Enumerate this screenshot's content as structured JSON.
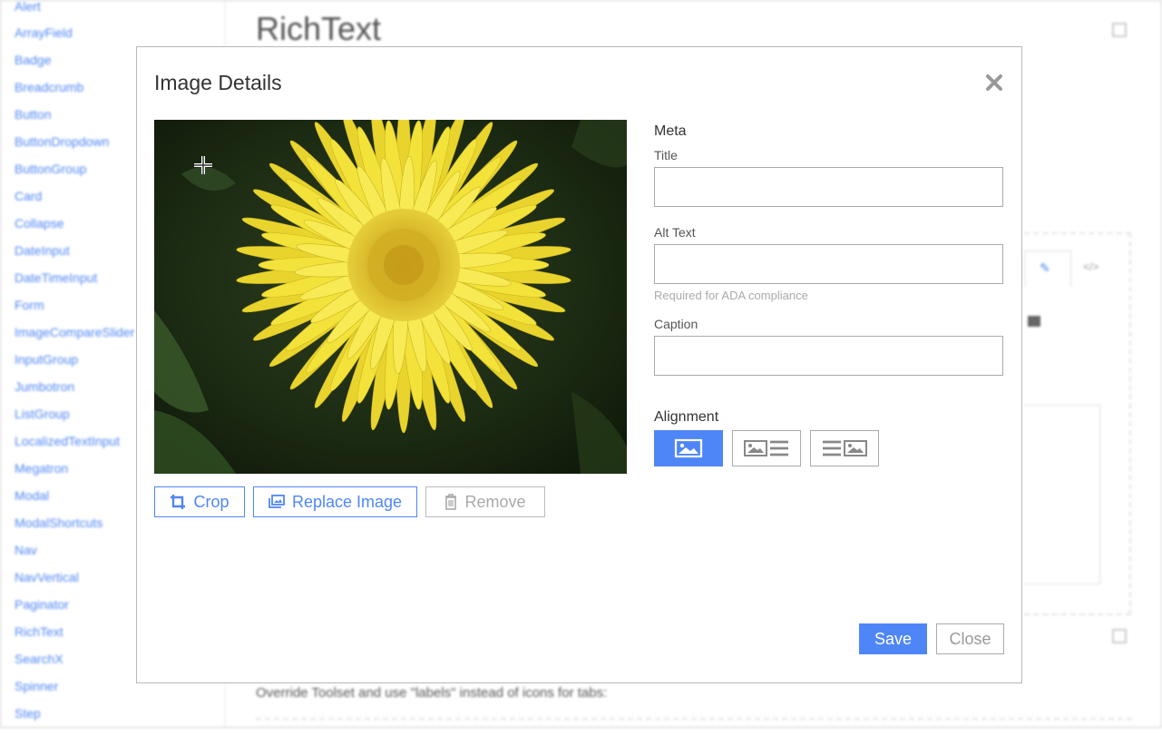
{
  "background": {
    "page_title": "RichText",
    "sidebar_items": [
      "Alert",
      "ArrayField",
      "Badge",
      "Breadcrumb",
      "Button",
      "ButtonDropdown",
      "ButtonGroup",
      "Card",
      "Collapse",
      "DateInput",
      "DateTimeInput",
      "Form",
      "ImageCompareSlider",
      "InputGroup",
      "Jumbotron",
      "ListGroup",
      "LocalizedTextInput",
      "Megatron",
      "Modal",
      "ModalShortcuts",
      "Nav",
      "NavVertical",
      "Paginator",
      "RichText",
      "SearchX",
      "Spinner",
      "Step"
    ],
    "override_text": "Override Toolset and use \"labels\" instead of icons for tabs:"
  },
  "modal": {
    "title": "Image Details",
    "image_alt": "Yellow gerbera daisy",
    "buttons": {
      "crop": "Crop",
      "replace": "Replace Image",
      "remove": "Remove"
    },
    "meta": {
      "heading": "Meta",
      "title_label": "Title",
      "title_value": "",
      "alt_label": "Alt Text",
      "alt_value": "",
      "alt_help": "Required for ADA compliance",
      "caption_label": "Caption",
      "caption_value": ""
    },
    "alignment": {
      "heading": "Alignment",
      "options": [
        "center",
        "left",
        "right"
      ],
      "selected": "center"
    },
    "footer": {
      "save": "Save",
      "close": "Close"
    },
    "colors": {
      "accent": "#4f86f7",
      "petal": "#f3e23a",
      "foliage": "#1c2a12"
    }
  }
}
